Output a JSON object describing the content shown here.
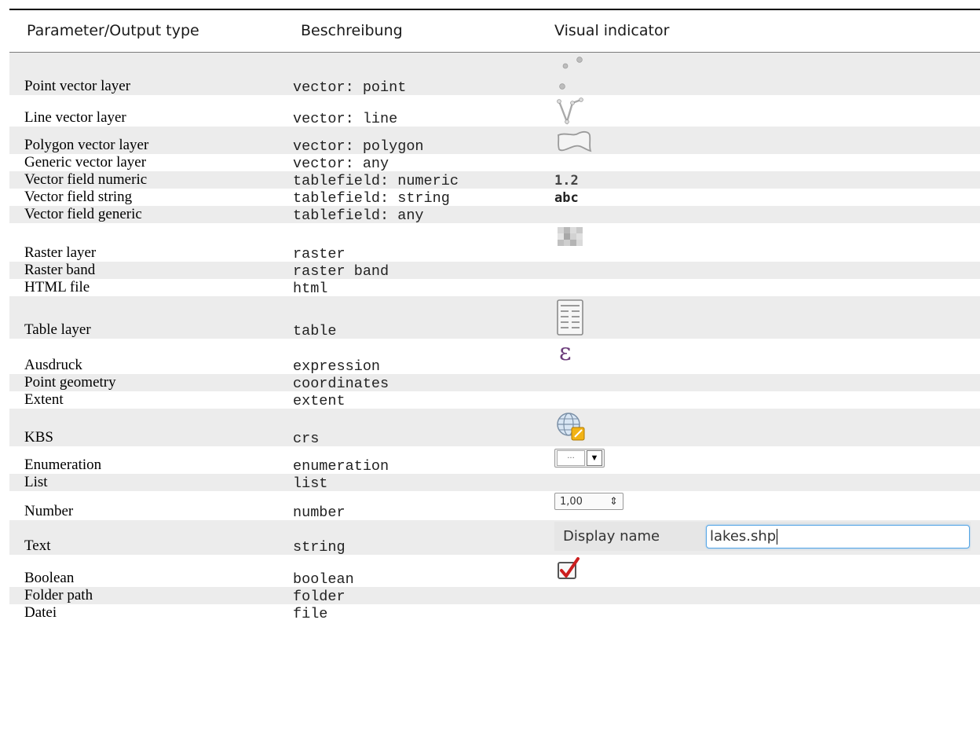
{
  "header": {
    "col1": "Parameter/Output type",
    "col2": "Beschreibung",
    "col3": "Visual indicator"
  },
  "rows": [
    {
      "name": "Point vector layer",
      "desc": "vector: point",
      "indicator": "point-vector-icon"
    },
    {
      "name": "Line vector layer",
      "desc": "vector: line",
      "indicator": "line-vector-icon"
    },
    {
      "name": "Polygon vector layer",
      "desc": "vector: polygon",
      "indicator": "polygon-vector-icon"
    },
    {
      "name": "Generic vector layer",
      "desc": "vector: any",
      "indicator": ""
    },
    {
      "name": "Vector field numeric",
      "desc": "tablefield: numeric",
      "indicator_text": "1.2"
    },
    {
      "name": "Vector field string",
      "desc": "tablefield: string",
      "indicator_text": "abc"
    },
    {
      "name": "Vector field generic",
      "desc": "tablefield: any",
      "indicator": ""
    },
    {
      "name": "Raster layer",
      "desc": "raster",
      "indicator": "raster-icon"
    },
    {
      "name": "Raster band",
      "desc": "raster band",
      "indicator": ""
    },
    {
      "name": "HTML file",
      "desc": "html",
      "indicator": ""
    },
    {
      "name": "Table layer",
      "desc": "table",
      "indicator": "table-icon"
    },
    {
      "name": "Ausdruck",
      "desc": "expression",
      "indicator": "expression-icon"
    },
    {
      "name": "Point geometry",
      "desc": "coordinates",
      "indicator": ""
    },
    {
      "name": "Extent",
      "desc": "extent",
      "indicator": ""
    },
    {
      "name": "KBS",
      "desc": "crs",
      "indicator": "crs-globe-icon"
    },
    {
      "name": "Enumeration",
      "desc": "enumeration",
      "indicator": "enumeration-combo-icon"
    },
    {
      "name": "List",
      "desc": "list",
      "indicator": ""
    },
    {
      "name": "Number",
      "desc": "number",
      "indicator": "number-spinbox",
      "spin_value": "1,00"
    },
    {
      "name": "Text",
      "desc": "string",
      "indicator": "text-field",
      "display_label": "Display name",
      "display_value": "lakes.shp"
    },
    {
      "name": "Boolean",
      "desc": "boolean",
      "indicator": "checkbox-checked-icon"
    },
    {
      "name": "Folder path",
      "desc": "folder",
      "indicator": ""
    },
    {
      "name": "Datei",
      "desc": "file",
      "indicator": ""
    }
  ],
  "colors": {
    "stripe": "#ececec",
    "expression": "#6b3b7a",
    "check": "#cc1f1f",
    "focus": "#56a6e6"
  }
}
